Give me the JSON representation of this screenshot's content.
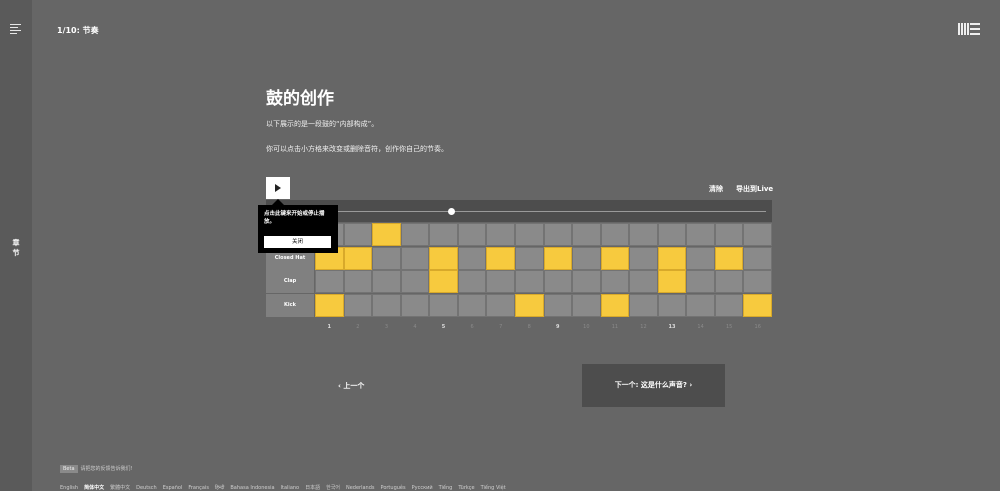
{
  "sidebar": {
    "chapters_label": "章节"
  },
  "header": {
    "progress": "1/10: 节奏"
  },
  "lesson": {
    "title": "鼓的创作",
    "desc1": "以下展示的是一段鼓的“内部构成”。",
    "desc2": "你可以点击小方格来改变或删除音符，创作你自己的节奏。"
  },
  "toolbar": {
    "clear": "清除",
    "export": "导出到Live"
  },
  "tooltip": {
    "text": "点击此键来开始或停止播放。",
    "close": "关闭"
  },
  "sequencer": {
    "steps": 16,
    "playhead": 0.3,
    "rows": [
      {
        "name": "",
        "pattern": [
          0,
          0,
          1,
          0,
          0,
          0,
          0,
          0,
          0,
          0,
          0,
          0,
          0,
          0,
          0,
          0
        ]
      },
      {
        "name": "Closed Hat",
        "pattern": [
          1,
          1,
          0,
          0,
          1,
          0,
          1,
          0,
          1,
          0,
          1,
          0,
          1,
          0,
          1,
          0
        ]
      },
      {
        "name": "Clap",
        "pattern": [
          0,
          0,
          0,
          0,
          1,
          0,
          0,
          0,
          0,
          0,
          0,
          0,
          1,
          0,
          0,
          0
        ]
      },
      {
        "name": "Kick",
        "pattern": [
          1,
          0,
          0,
          0,
          0,
          0,
          0,
          1,
          0,
          0,
          1,
          0,
          0,
          0,
          0,
          1
        ]
      }
    ],
    "step_numbers": [
      "1",
      "2",
      "3",
      "4",
      "5",
      "6",
      "7",
      "8",
      "9",
      "10",
      "11",
      "12",
      "13",
      "14",
      "15",
      "16"
    ],
    "bold_steps": [
      1,
      5,
      9,
      13
    ],
    "colors": {
      "on": "#f7ca3e",
      "off": "#8a8a8a"
    }
  },
  "nav": {
    "prev": "‹ 上一个",
    "next": "下一个: 这是什么声音? ›"
  },
  "footer": {
    "beta": "Beta",
    "feedback": "请把您的反馈告诉我们!",
    "languages": [
      "English",
      "简体中文",
      "繁體中文",
      "Deutsch",
      "Español",
      "Français",
      "हिन्दी",
      "Bahasa Indonesia",
      "Italiano",
      "日本語",
      "한국어",
      "Nederlands",
      "Português",
      "Русский",
      "Tiếng",
      "Türkçe",
      "Tiếng Việt"
    ],
    "active_language": "简体中文"
  }
}
